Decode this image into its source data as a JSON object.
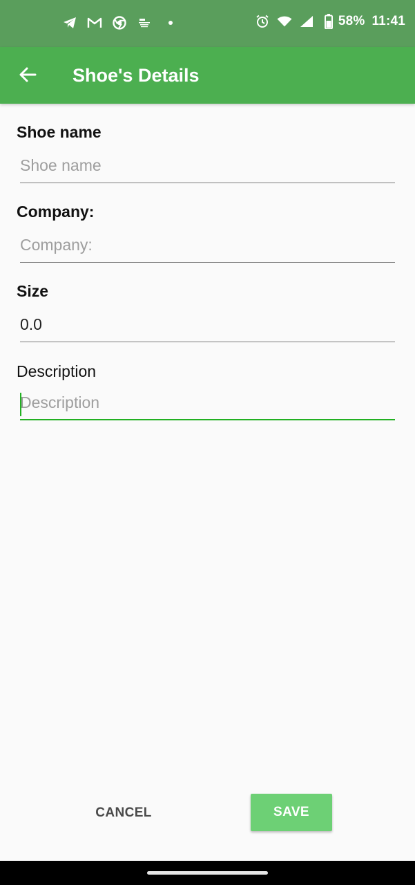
{
  "status_bar": {
    "battery_percent": "58%",
    "time": "11:41",
    "icons_left": [
      "telegram-icon",
      "gmail-icon",
      "chrome-icon",
      "news-app-icon",
      "more-notifications-dot"
    ],
    "icons_right": [
      "alarm-icon",
      "wifi-icon",
      "cellular-signal-icon",
      "battery-icon"
    ]
  },
  "app_bar": {
    "title": "Shoe's Details",
    "back_icon": "arrow-back-icon"
  },
  "form": {
    "shoe_name": {
      "label": "Shoe name",
      "placeholder": "Shoe name",
      "value": ""
    },
    "company": {
      "label": "Company:",
      "placeholder": "Company:",
      "value": ""
    },
    "size": {
      "label": "Size",
      "placeholder": "",
      "value": "0.0"
    },
    "description": {
      "label": "Description",
      "placeholder": "Description",
      "value": ""
    }
  },
  "actions": {
    "cancel_label": "CANCEL",
    "save_label": "SAVE"
  },
  "colors": {
    "status_bar": "#5a9e5c",
    "app_bar": "#4caf50",
    "accent": "#22b022",
    "save_button": "#6dd075"
  }
}
